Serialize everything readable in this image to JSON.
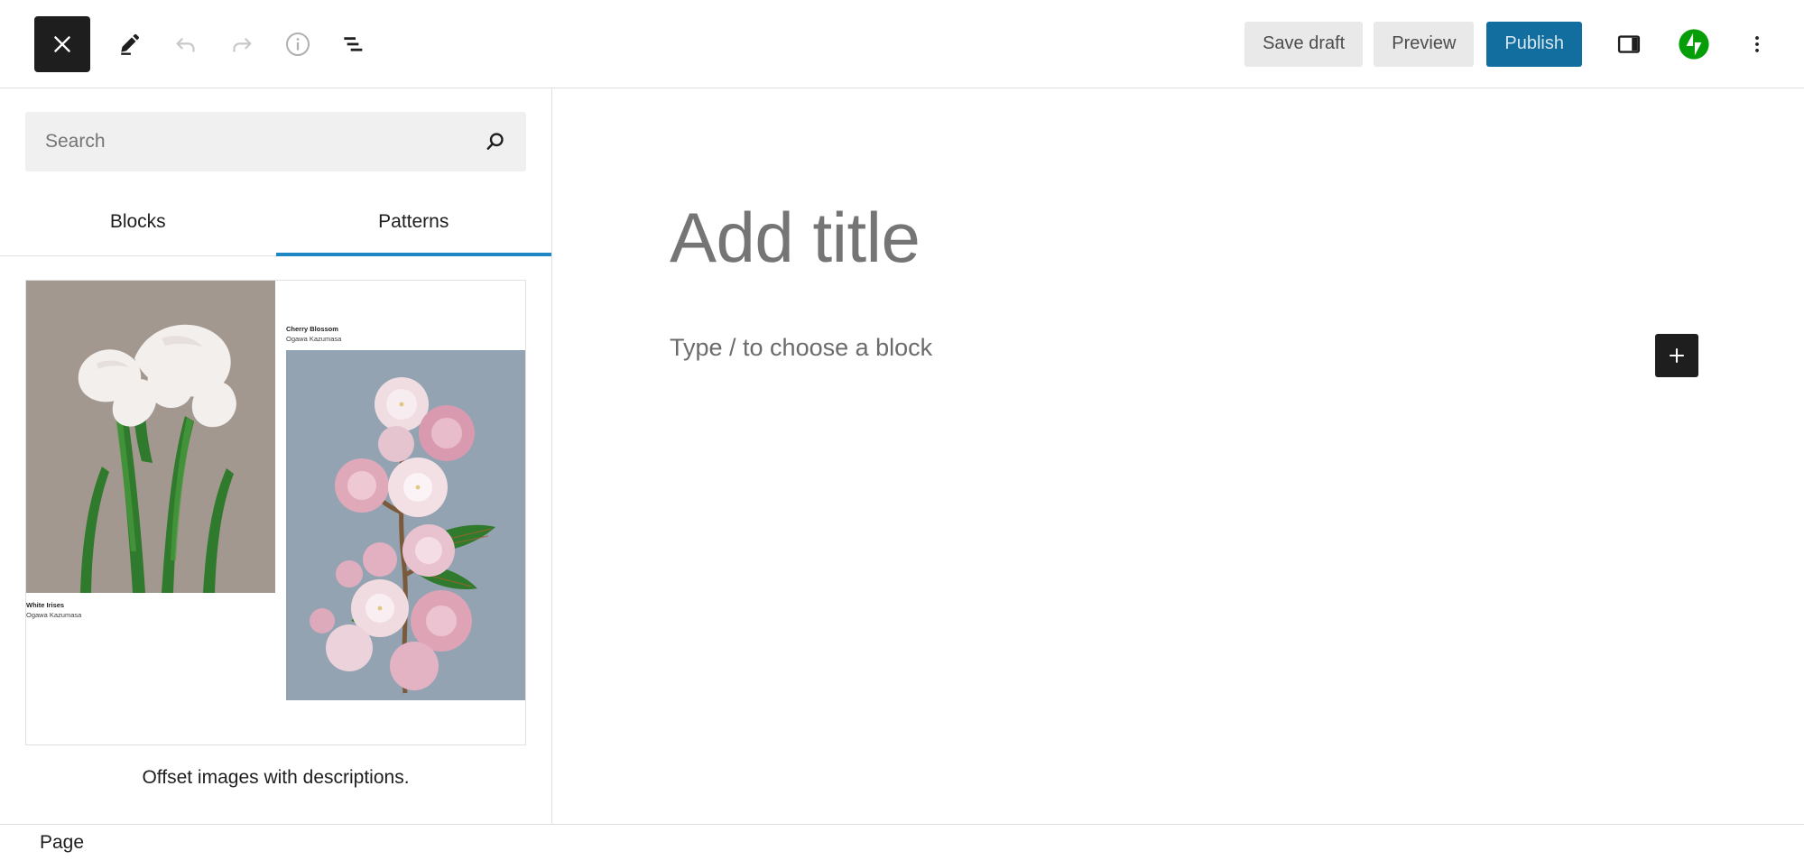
{
  "header": {
    "close_label": "Close",
    "tools": [
      {
        "name": "close-icon",
        "label": "Close"
      },
      {
        "name": "edit-pencil-icon",
        "label": "Edit"
      },
      {
        "name": "undo-icon",
        "label": "Undo"
      },
      {
        "name": "redo-icon",
        "label": "Redo"
      },
      {
        "name": "details-info-icon",
        "label": "Details"
      },
      {
        "name": "list-view-icon",
        "label": "List View"
      }
    ],
    "save_draft_label": "Save draft",
    "preview_label": "Preview",
    "publish_label": "Publish",
    "sidebar_toggle_name": "sidebar-toggle-icon",
    "jetpack_name": "jetpack-icon",
    "more_menu_name": "more-vertical-icon",
    "publish_bg": "#126e9e",
    "jetpack_green": "#069e08"
  },
  "inserter": {
    "search": {
      "placeholder": "Search",
      "value": "",
      "icon": "search-icon"
    },
    "tabs": [
      {
        "label": "Blocks",
        "active": false
      },
      {
        "label": "Patterns",
        "active": true
      }
    ],
    "active_tab_color": "#1e87c4",
    "patterns": [
      {
        "label": "Offset images with descriptions.",
        "images": [
          {
            "title": "White Irises",
            "artist": "Ogawa Kazumasa",
            "caption_position": "below"
          },
          {
            "title": "Cherry Blossom",
            "artist": "Ogawa Kazumasa",
            "caption_position": "above"
          }
        ]
      }
    ]
  },
  "canvas": {
    "title_placeholder": "Add title",
    "block_prompt": "Type / to choose a block",
    "add_block_label": "+"
  },
  "footer": {
    "breadcrumb": "Page"
  }
}
